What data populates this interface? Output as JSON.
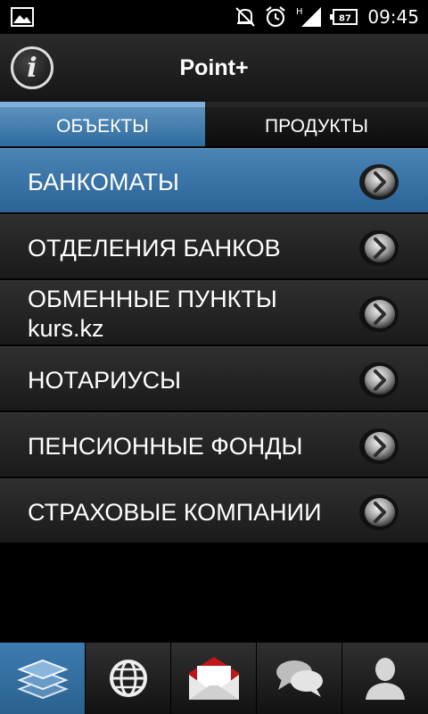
{
  "status_bar": {
    "time": "09:45",
    "battery": "87",
    "network": "H",
    "icons": [
      "image-icon",
      "muted-icon",
      "alarm-icon",
      "signal-icon",
      "battery-icon"
    ]
  },
  "header": {
    "title": "Point+",
    "info_icon": "info-icon"
  },
  "tabs": [
    {
      "label": "ОБЪЕКТЫ",
      "active": true
    },
    {
      "label": "ПРОДУКТЫ",
      "active": false
    }
  ],
  "list": {
    "items": [
      {
        "label": "БАНКОМАТЫ",
        "active": true
      },
      {
        "label": "ОТДЕЛЕНИЯ БАНКОВ",
        "active": false
      },
      {
        "label": "ОБМЕННЫЕ ПУНКТЫ",
        "sublabel": "kurs.kz",
        "active": false
      },
      {
        "label": "НОТАРИУСЫ",
        "active": false
      },
      {
        "label": "ПЕНСИОННЫЕ ФОНДЫ",
        "active": false
      },
      {
        "label": "СТРАХОВЫЕ КОМПАНИИ",
        "active": false
      }
    ]
  },
  "bottom_nav": {
    "items": [
      {
        "icon": "layers-icon",
        "active": true
      },
      {
        "icon": "globe-icon",
        "active": false
      },
      {
        "icon": "mail-icon",
        "active": false
      },
      {
        "icon": "chat-icon",
        "active": false
      },
      {
        "icon": "user-icon",
        "active": false
      }
    ]
  },
  "colors": {
    "accent": "#2d6b9f",
    "background": "#000000",
    "row": "#252525"
  }
}
